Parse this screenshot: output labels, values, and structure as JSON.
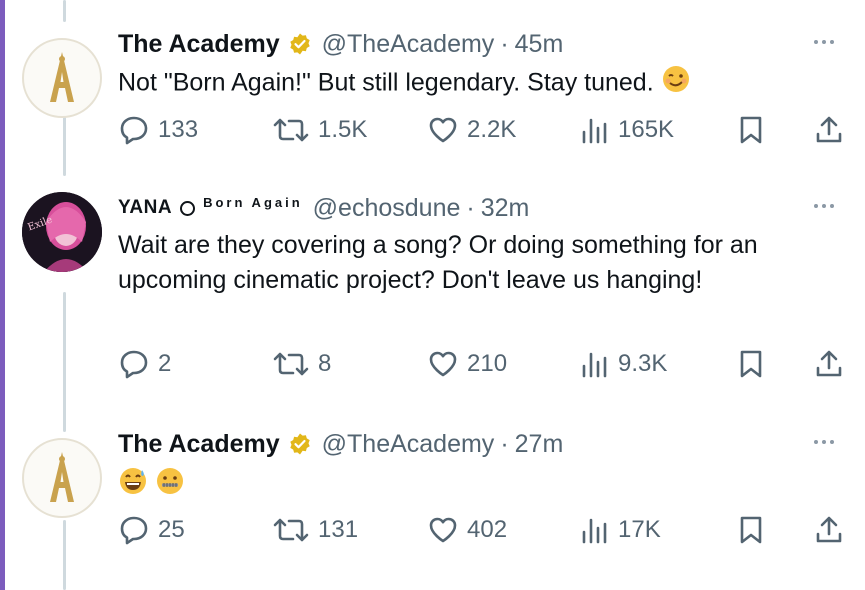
{
  "tweets": [
    {
      "author_name": "The Academy",
      "handle": "@TheAcademy",
      "dot": "·",
      "time": "45m",
      "text": "Not \"Born Again!\" But still legendary. Stay tuned.",
      "emoji": [
        "winking-face"
      ],
      "replies": "133",
      "retweets": "1.5K",
      "likes": "2.2K",
      "views": "165K"
    },
    {
      "author_name": "YANA",
      "name_suffix": "Born Again",
      "handle": "@echosdune",
      "dot": "·",
      "time": "32m",
      "text": "Wait are they covering a song? Or doing something for an upcoming cinematic project? Don't leave us hanging!",
      "replies": "2",
      "retweets": "8",
      "likes": "210",
      "views": "9.3K"
    },
    {
      "author_name": "The Academy",
      "handle": "@TheAcademy",
      "dot": "·",
      "time": "27m",
      "text": "",
      "emoji": [
        "grinning-sweat-face",
        "zipper-mouth-face"
      ],
      "replies": "25",
      "retweets": "131",
      "likes": "402",
      "views": "17K"
    }
  ],
  "colors": {
    "accent_bar": "#7c5cbd",
    "verified_gold": "#e2b719",
    "secondary_text": "#536471",
    "thread_line": "#cfd9de"
  },
  "icons": [
    "reply-icon",
    "retweet-icon",
    "like-icon",
    "views-icon",
    "bookmark-icon",
    "share-icon",
    "more-icon",
    "verified-badge-icon",
    "oscar-logo-icon"
  ]
}
